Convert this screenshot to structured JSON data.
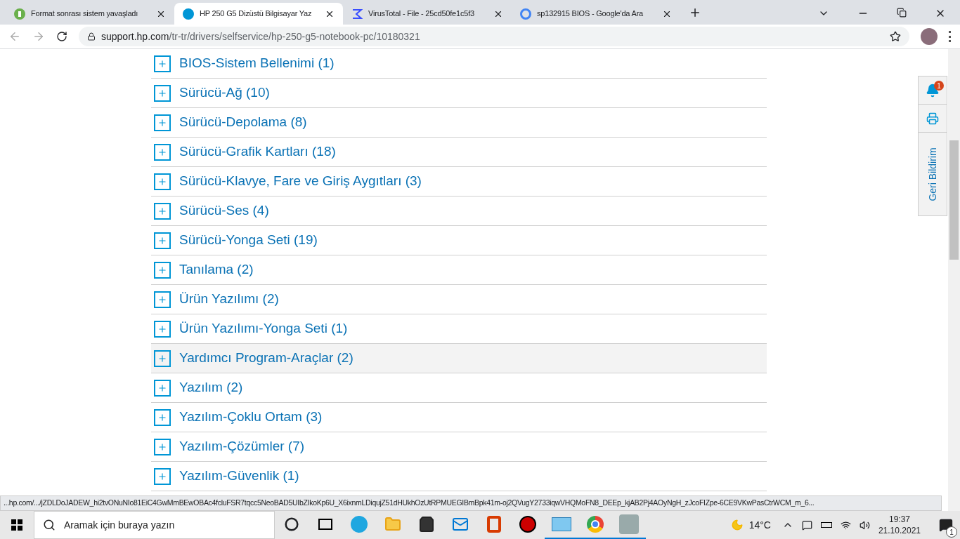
{
  "tabs": [
    {
      "title": "Format sonrası sistem yavaşladı",
      "selected": false
    },
    {
      "title": "HP 250 G5 Dizüstü Bilgisayar Yaz",
      "selected": true
    },
    {
      "title": "VirusTotal - File - 25cd50fe1c5f3",
      "selected": false
    },
    {
      "title": "sp132915 BIOS - Google'da Ara",
      "selected": false
    }
  ],
  "address": {
    "host": "support.hp.com",
    "path": "/tr-tr/drivers/selfservice/hp-250-g5-notebook-pc/10180321"
  },
  "categories": [
    {
      "label": "BIOS-Sistem Bellenimi (1)",
      "highlighted": false
    },
    {
      "label": "Sürücü-Ağ (10)",
      "highlighted": false
    },
    {
      "label": "Sürücü-Depolama (8)",
      "highlighted": false
    },
    {
      "label": "Sürücü-Grafik Kartları (18)",
      "highlighted": false
    },
    {
      "label": "Sürücü-Klavye, Fare ve Giriş Aygıtları (3)",
      "highlighted": false
    },
    {
      "label": "Sürücü-Ses (4)",
      "highlighted": false
    },
    {
      "label": "Sürücü-Yonga Seti (19)",
      "highlighted": false
    },
    {
      "label": "Tanılama (2)",
      "highlighted": false
    },
    {
      "label": "Ürün Yazılımı (2)",
      "highlighted": false
    },
    {
      "label": "Ürün Yazılımı-Yonga Seti (1)",
      "highlighted": false
    },
    {
      "label": "Yardımcı Program-Araçlar (2)",
      "highlighted": true
    },
    {
      "label": "Yazılım (2)",
      "highlighted": false
    },
    {
      "label": "Yazılım-Çoklu Ortam (3)",
      "highlighted": false
    },
    {
      "label": "Yazılım-Çözümler (7)",
      "highlighted": false
    },
    {
      "label": "Yazılım-Güvenlik (1)",
      "highlighted": false
    }
  ],
  "side_widget": {
    "notification_count": "1",
    "feedback": "Geri Bildirim"
  },
  "status_url": "...hp.com/.../jZDLDoJADEW_hi2tvONuNIo81EiC4GwMmBEwOBAc4fcluFSR7tqcc5NeoBAD5UIbZIkoKp6U_X6ixnmLDiqujZ51dHUkhOzUtRPMUEGIBmBpk41m-oj2QVugY2733iqwVHQMoFN8_DEEp_kjAB2Pj4AOyNgH_zJcoFIZpe-6CE9VKwPasCtrWCM_m_6...",
  "taskbar": {
    "search_placeholder": "Aramak için buraya yazın",
    "apps": [
      {
        "active": false
      },
      {
        "active": false
      },
      {
        "active": false
      },
      {
        "active": false
      },
      {
        "active": false
      },
      {
        "active": false
      },
      {
        "active": false
      },
      {
        "active": false
      },
      {
        "active": true
      },
      {
        "active": true
      },
      {
        "active": true
      }
    ],
    "weather": "14°C",
    "time": "19:37",
    "date": "21.10.2021",
    "notifications": "1"
  }
}
